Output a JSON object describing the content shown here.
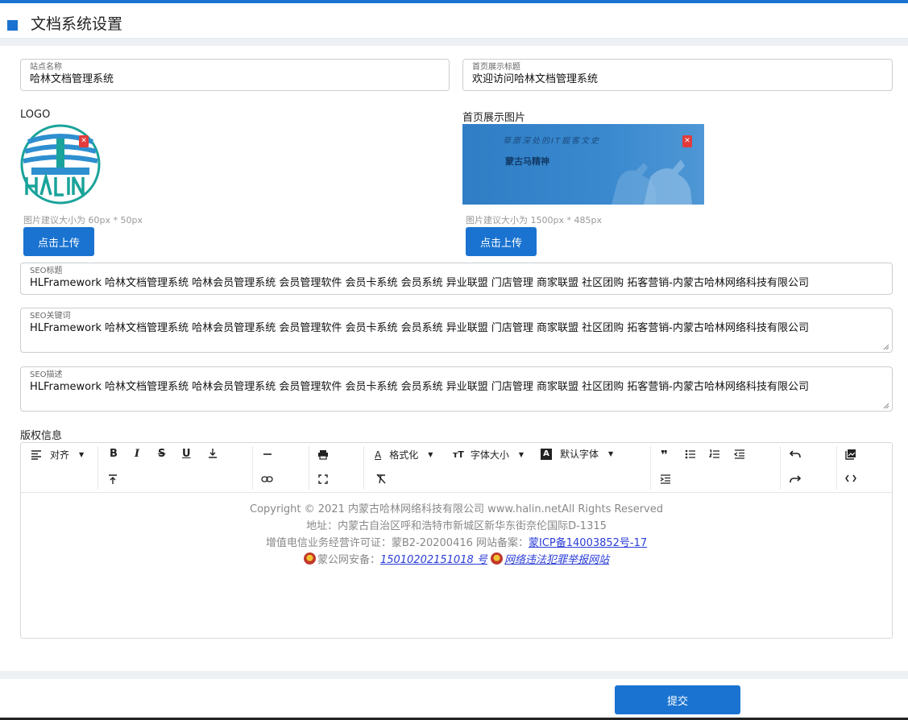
{
  "header": {
    "title": "文档系统设置"
  },
  "site_name": {
    "label": "站点名称",
    "value": "哈林文档管理系统"
  },
  "home_title": {
    "label": "首页展示标题",
    "value": "欢迎访问哈林文档管理系统"
  },
  "logo": {
    "label": "LOGO",
    "hint": "图片建议大小为 60px * 50px",
    "upload_label": "点击上传",
    "image_text": "HALIN"
  },
  "home_image": {
    "label": "首页展示图片",
    "hint": "图片建议大小为 1500px * 485px",
    "upload_label": "点击上传",
    "banner_top": "草原深处的IT掘客文史",
    "banner_main": "蒙古马精神"
  },
  "seo_title": {
    "label": "SEO标题",
    "value": "HLFramework 哈林文档管理系统 哈林会员管理系统 会员管理软件 会员卡系统 会员系统 异业联盟 门店管理 商家联盟 社区团购 拓客营销-内蒙古哈林网络科技有限公司"
  },
  "seo_keywords": {
    "label": "SEO关键词",
    "value": "HLFramework 哈林文档管理系统 哈林会员管理系统 会员管理软件 会员卡系统 会员系统 异业联盟 门店管理 商家联盟 社区团购 拓客营销-内蒙古哈林网络科技有限公司"
  },
  "seo_desc": {
    "label": "SEO描述",
    "value": "HLFramework 哈林文档管理系统 哈林会员管理系统 会员管理软件 会员卡系统 会员系统 异业联盟 门店管理 商家联盟 社区团购 拓客营销-内蒙古哈林网络科技有限公司"
  },
  "copyright": {
    "label": "版权信息",
    "toolbar": {
      "align": "对齐",
      "format": "格式化",
      "font_size": "字体大小",
      "font_family": "默认字体"
    },
    "line1": "Copyright © 2021 内蒙古哈林网络科技有限公司   www.halin.netAll Rights Reserved",
    "line2": "地址：内蒙古自治区呼和浩特市新城区新华东街奈伦国际D-1315",
    "line3_prefix": "增值电信业务经营许可证：蒙B2-20200416 网站备案：",
    "line3_link": "蒙ICP备14003852号-17",
    "line4_prefix": "蒙公网安备：",
    "line4_link": "15010202151018 号",
    "line4_link2": "网络违法犯罪举报网站"
  },
  "submit_label": "提交",
  "colors": {
    "accent": "#1a73d0",
    "danger": "#e23b3b",
    "link": "#2a3dd6"
  }
}
